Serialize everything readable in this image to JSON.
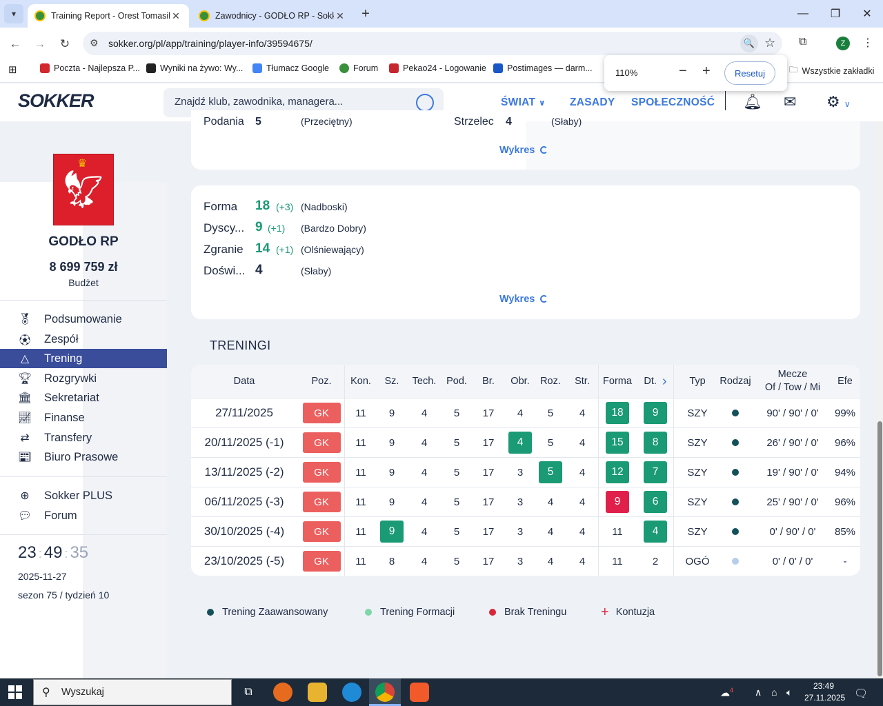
{
  "browser": {
    "tabs": [
      {
        "title": "Training Report - Orest Tomasik",
        "active": true
      },
      {
        "title": "Zawodnicy - GODŁO RP - Sokker",
        "active": false
      }
    ],
    "url": "sokker.org/pl/app/training/player-info/39594675/",
    "bookmarks": [
      {
        "label": "Poczta - Najlepsza P...",
        "color": "#d3262f"
      },
      {
        "label": "Wyniki na żywo: Wy...",
        "color": "#222222"
      },
      {
        "label": "Tłumacz Google",
        "color": "#4285f4"
      },
      {
        "label": "Forum",
        "color": "#3a8f3a"
      },
      {
        "label": "Pekao24 - Logowanie",
        "color": "#c8262e"
      },
      {
        "label": "Postimages — darm...",
        "color": "#1a57c6"
      }
    ],
    "all_bookmarks": "Wszystkie zakładki",
    "profile_initial": "Z",
    "zoom": {
      "percent": "110%",
      "reset": "Resetuj"
    }
  },
  "site": {
    "logo": "SOKKER",
    "search_placeholder": "Znajdź klub, zawodnika, managera...",
    "nav": {
      "world": "ŚWIAT",
      "rules": "ZASADY",
      "community": "SPOŁECZNOŚĆ"
    }
  },
  "sidebar": {
    "club_name": "GODŁO RP",
    "budget": "8 699 759 zł",
    "budget_label": "Budżet",
    "menu": [
      {
        "label": "Podsumowanie",
        "icon": "medal-icon"
      },
      {
        "label": "Zespół",
        "icon": "ball-icon"
      },
      {
        "label": "Trening",
        "icon": "cone-icon",
        "active": true
      },
      {
        "label": "Rozgrywki",
        "icon": "trophy-icon"
      },
      {
        "label": "Sekretariat",
        "icon": "building-icon"
      },
      {
        "label": "Finanse",
        "icon": "chart-icon"
      },
      {
        "label": "Transfery",
        "icon": "transfer-icon"
      },
      {
        "label": "Biuro Prasowe",
        "icon": "newspaper-icon"
      }
    ],
    "extra": [
      {
        "label": "Sokker PLUS",
        "icon": "plus-circle-icon"
      },
      {
        "label": "Forum",
        "icon": "chat-icon"
      }
    ],
    "clock": {
      "h": "23",
      "m": "49",
      "s": "35"
    },
    "date": "2025-11-27",
    "season": "sezon 75 / tydzień 10"
  },
  "skills_partial": {
    "left_label": "Podania",
    "left_value": "5",
    "left_desc": "(Przeciętny)",
    "right_label": "Strzelec",
    "right_value": "4",
    "right_desc": "(Słaby)",
    "chart_link": "Wykres"
  },
  "attributes": {
    "items": [
      {
        "label": "Forma",
        "value": "18",
        "delta": "(+3)",
        "desc": "(Nadboski)"
      },
      {
        "label": "Dyscy...",
        "value": "9",
        "delta": "(+1)",
        "desc": "(Bardzo Dobry)"
      },
      {
        "label": "Zgranie",
        "value": "14",
        "delta": "(+1)",
        "desc": "(Olśniewający)"
      },
      {
        "label": "Doświ...",
        "value": "4",
        "delta": "",
        "desc": "(Słaby)"
      }
    ],
    "chart_link": "Wykres"
  },
  "training": {
    "title": "TRENINGI",
    "headers": {
      "date": "Data",
      "pos": "Poz.",
      "kon": "Kon.",
      "sz": "Sz.",
      "tech": "Tech.",
      "pod": "Pod.",
      "br": "Br.",
      "obr": "Obr.",
      "roz": "Roz.",
      "str": "Str.",
      "forma": "Forma",
      "dt": "Dt.",
      "typ": "Typ",
      "rodzaj": "Rodzaj",
      "mecze_1": "Mecze",
      "mecze_2": "Of / Tow / Mi",
      "efe": "Efe"
    },
    "rows": [
      {
        "date": "27/11/2025",
        "pos": "GK",
        "kon": "11",
        "sz": "9",
        "tech": "4",
        "pod": "5",
        "br": "17",
        "obr": "4",
        "roz": "5",
        "str": "4",
        "forma": "18",
        "dt": "9",
        "typ": "SZY",
        "matches": "90' / 90' / 0'",
        "efe": "99%"
      },
      {
        "date": "20/11/2025 (-1)",
        "pos": "GK",
        "kon": "11",
        "sz": "9",
        "tech": "4",
        "pod": "5",
        "br": "17",
        "obr": "4",
        "roz": "5",
        "str": "4",
        "forma": "15",
        "dt": "8",
        "typ": "SZY",
        "matches": "26' / 90' / 0'",
        "efe": "96%"
      },
      {
        "date": "13/11/2025 (-2)",
        "pos": "GK",
        "kon": "11",
        "sz": "9",
        "tech": "4",
        "pod": "5",
        "br": "17",
        "obr": "3",
        "roz": "5",
        "str": "4",
        "forma": "12",
        "dt": "7",
        "typ": "SZY",
        "matches": "19' / 90' / 0'",
        "efe": "94%"
      },
      {
        "date": "06/11/2025 (-3)",
        "pos": "GK",
        "kon": "11",
        "sz": "9",
        "tech": "4",
        "pod": "5",
        "br": "17",
        "obr": "3",
        "roz": "4",
        "str": "4",
        "forma": "9",
        "dt": "6",
        "typ": "SZY",
        "matches": "25' / 90' / 0'",
        "efe": "96%"
      },
      {
        "date": "30/10/2025 (-4)",
        "pos": "GK",
        "kon": "11",
        "sz": "9",
        "tech": "4",
        "pod": "5",
        "br": "17",
        "obr": "3",
        "roz": "4",
        "str": "4",
        "forma": "11",
        "dt": "4",
        "typ": "SZY",
        "matches": "0' / 90' / 0'",
        "efe": "85%"
      },
      {
        "date": "23/10/2025 (-5)",
        "pos": "GK",
        "kon": "11",
        "sz": "8",
        "tech": "4",
        "pod": "5",
        "br": "17",
        "obr": "3",
        "roz": "4",
        "str": "4",
        "forma": "11",
        "dt": "2",
        "typ": "OGÓ",
        "matches": "0' / 0' / 0'",
        "efe": "-"
      }
    ],
    "legend": [
      {
        "label": "Trening Zaawansowany",
        "color": "#14505a"
      },
      {
        "label": "Trening Formacji",
        "color": "#7fd6a8"
      },
      {
        "label": "Brak Treningu",
        "color": "#d9263a"
      },
      {
        "label": "Kontuzja",
        "color": "#d9263a"
      }
    ],
    "colors": {
      "up": "#1a9a75",
      "down": "#e0204a",
      "gk": "#ec5f5f",
      "advanced": "#14505a",
      "general": "#b8cdea"
    }
  },
  "taskbar": {
    "search": "Wyszukaj",
    "time": "23:49",
    "date": "27.11.2025",
    "weather_badge": "4"
  }
}
